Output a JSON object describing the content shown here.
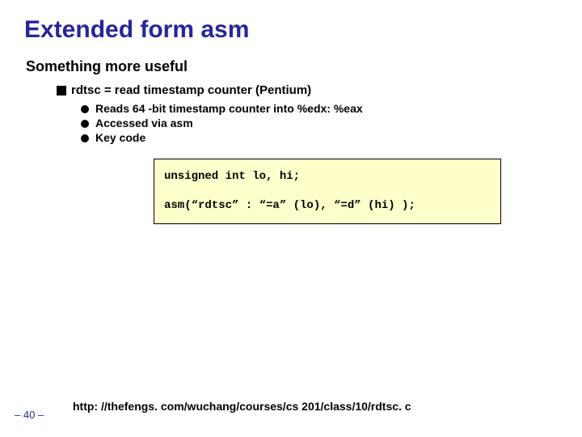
{
  "title": "Extended form asm",
  "section": "Something more useful",
  "item1": "rdtsc = read timestamp counter (Pentium)",
  "sub": {
    "a": "Reads 64 -bit timestamp counter into %edx: %eax",
    "b": "Accessed via asm",
    "c": "Key code"
  },
  "code": {
    "line1": "unsigned int lo, hi;",
    "line2": "asm(“rdtsc” : “=a” (lo), “=d” (hi) );"
  },
  "footer_link": "http: //thefengs. com/wuchang/courses/cs 201/class/10/rdtsc. c",
  "page_number": "– 40 –"
}
